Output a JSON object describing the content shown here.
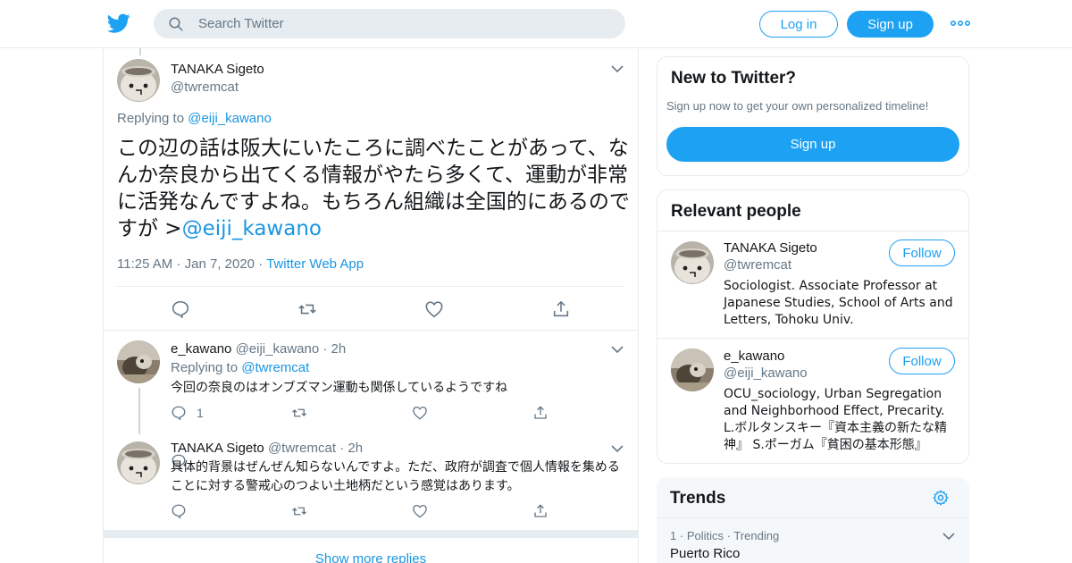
{
  "header": {
    "search_placeholder": "Search Twitter",
    "login_label": "Log in",
    "signup_label": "Sign up",
    "brand_color": "#1da1f2"
  },
  "main_tweet": {
    "name": "TANAKA Sigeto",
    "handle": "@twremcat",
    "replying_prefix": "Replying to",
    "replying_to": "@eiji_kawano",
    "text": "この辺の話は阪大にいたころに調べたことがあって、なんか奈良から出てくる情報がやたら多くて、運動が非常に活発なんですよね。もちろん組織は全国的にあるのですが >",
    "text_mention": "@eiji_kawano",
    "time": "11:25 AM",
    "date": "Jan 7, 2020",
    "source": "Twitter Web App"
  },
  "replies": [
    {
      "name": "e_kawano",
      "handle": "@eiji_kawano",
      "age": "2h",
      "replying_prefix": "Replying to",
      "replying_to": "@twremcat",
      "text": "今回の奈良のはオンブズマン運動も関係しているようですね",
      "reply_count": "1"
    },
    {
      "name": "TANAKA Sigeto",
      "handle": "@twremcat",
      "age": "2h",
      "text": "具体的背景はぜんぜん知らないんですよ。ただ、政府が調査で個人情報を集めることに対する警戒心のつよい土地柄だという感覚はあります。"
    }
  ],
  "show_more": "Show more replies",
  "sidebar": {
    "new_title": "New to Twitter?",
    "new_sub": "Sign up now to get your own personalized timeline!",
    "signup_label": "Sign up",
    "relevant_title": "Relevant people",
    "follow_label": "Follow",
    "people": [
      {
        "name": "TANAKA Sigeto",
        "handle": "@twremcat",
        "bio": "Sociologist. Associate Professor at Japanese Studies, School of Arts and Letters, Tohoku Univ."
      },
      {
        "name": "e_kawano",
        "handle": "@eiji_kawano",
        "bio": "OCU_sociology, Urban Segregation and Neighborhood Effect, Precarity. L.ボルタンスキー『資本主義の新たな精神』 S.ポーガム『貧困の基本形態』"
      }
    ],
    "trends_title": "Trends",
    "trend": {
      "rank": "1",
      "category": "Politics",
      "label": "Trending",
      "name": "Puerto Rico"
    }
  }
}
